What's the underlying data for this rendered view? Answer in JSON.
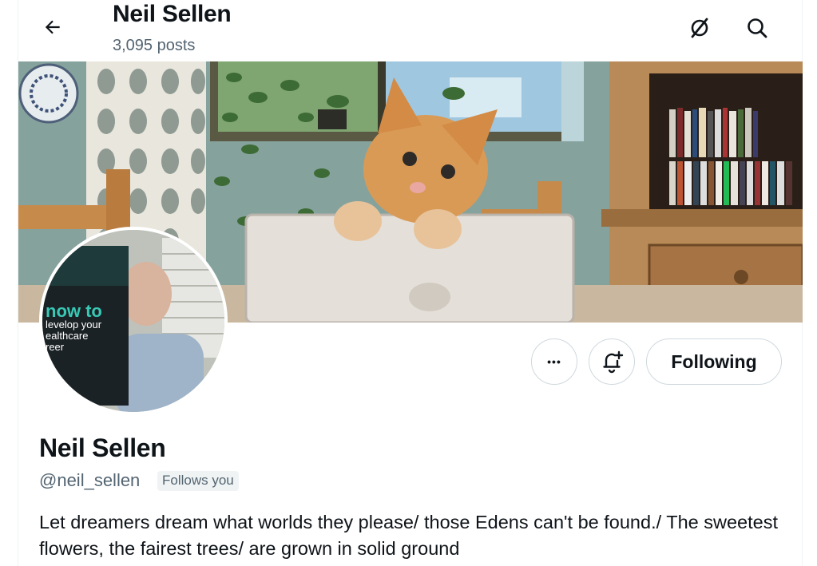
{
  "header": {
    "title": "Neil Sellen",
    "posts_count": "3,095 posts",
    "icons": [
      "back-arrow-icon",
      "grok-icon",
      "search-icon"
    ]
  },
  "banner": {
    "description_icon": "banner-photo"
  },
  "avatar": {
    "book_title_lines": [
      "now to",
      "levelop your",
      "ealthcare",
      "reer"
    ]
  },
  "actions": {
    "more_label": "•••",
    "following_label": "Following"
  },
  "profile": {
    "display_name": "Neil Sellen",
    "handle": "@neil_sellen",
    "follows_badge": "Follows you",
    "bio": "Let dreamers dream what worlds they please/ those Edens can't be found./ The sweetest flowers, the fairest trees/ are grown in solid ground"
  },
  "colors": {
    "text": "#0f1419",
    "secondary": "#536471",
    "border": "#cfd9de",
    "badge_bg": "#eff3f4"
  }
}
